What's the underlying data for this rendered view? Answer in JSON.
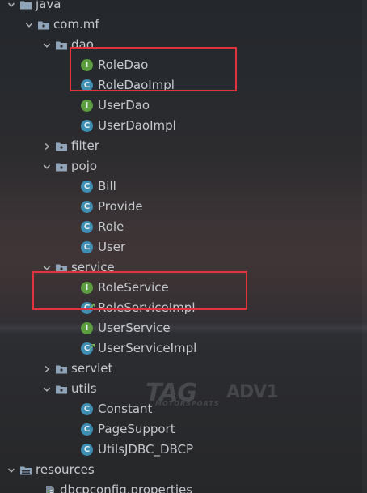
{
  "project_tree": {
    "items": [
      {
        "label": "java",
        "type": "folder",
        "expanded": true,
        "depth": 1
      },
      {
        "label": "com.mf",
        "type": "package",
        "expanded": true,
        "depth": 2
      },
      {
        "label": "dao",
        "type": "package",
        "expanded": true,
        "depth": 3
      },
      {
        "label": "RoleDao",
        "type": "interface",
        "depth": 4
      },
      {
        "label": "RoleDaoImpl",
        "type": "class",
        "depth": 4
      },
      {
        "label": "UserDao",
        "type": "interface",
        "depth": 4
      },
      {
        "label": "UserDaoImpl",
        "type": "class",
        "depth": 4
      },
      {
        "label": "filter",
        "type": "package",
        "expanded": false,
        "depth": 3
      },
      {
        "label": "pojo",
        "type": "package",
        "expanded": true,
        "depth": 3
      },
      {
        "label": "Bill",
        "type": "class",
        "depth": 4
      },
      {
        "label": "Provide",
        "type": "class",
        "depth": 4
      },
      {
        "label": "Role",
        "type": "class",
        "depth": 4
      },
      {
        "label": "User",
        "type": "class",
        "depth": 4
      },
      {
        "label": "service",
        "type": "package",
        "expanded": true,
        "depth": 3
      },
      {
        "label": "RoleService",
        "type": "interface",
        "depth": 4
      },
      {
        "label": "RoleServiceImpl",
        "type": "class-impl",
        "depth": 4
      },
      {
        "label": "UserService",
        "type": "interface",
        "depth": 4
      },
      {
        "label": "UserServiceImpl",
        "type": "class-impl",
        "depth": 4
      },
      {
        "label": "servlet",
        "type": "package",
        "expanded": false,
        "depth": 3
      },
      {
        "label": "utils",
        "type": "package",
        "expanded": true,
        "depth": 3
      },
      {
        "label": "Constant",
        "type": "class",
        "depth": 4
      },
      {
        "label": "PageSupport",
        "type": "class",
        "depth": 4
      },
      {
        "label": "UtilsJDBC_DBCP",
        "type": "class",
        "depth": 4
      },
      {
        "label": "resources",
        "type": "resources-folder",
        "expanded": true,
        "depth": 1
      },
      {
        "label": "dbcpconfig.properties",
        "type": "properties-file",
        "depth": 2
      }
    ]
  },
  "highlight_color": "#e0333f",
  "icon_colors": {
    "class": "#3f8fb4",
    "interface": "#5b9d3f",
    "folder": "#8fa4b8",
    "text": "#c6c9cd"
  },
  "icon_letters": {
    "class": "C",
    "interface": "I"
  },
  "background_watermark": {
    "main": "TAG",
    "sub": "MOTORSPORTS",
    "right": "ADV1"
  }
}
